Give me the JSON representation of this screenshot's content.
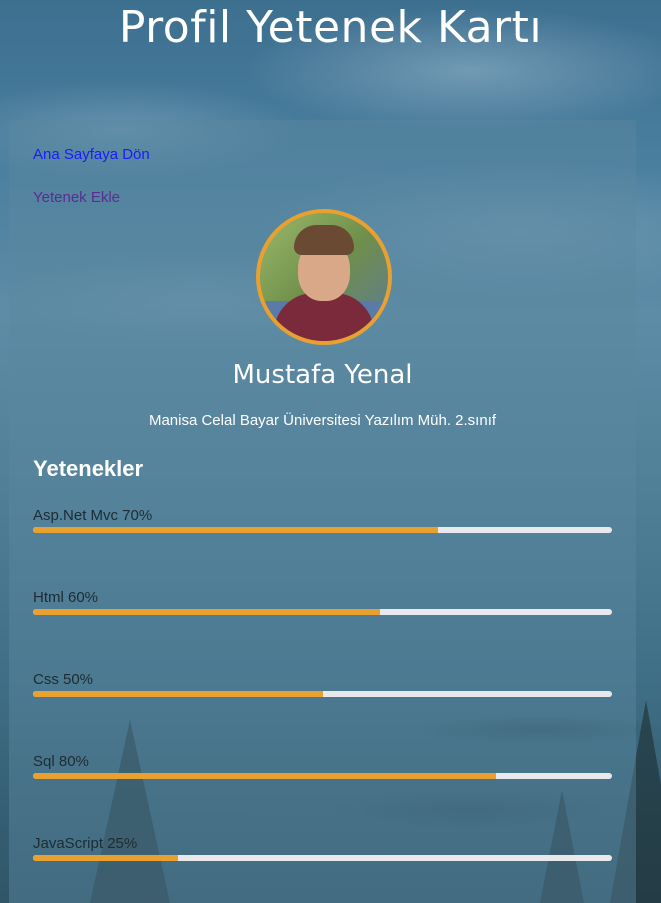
{
  "page": {
    "title": "Profil Yetenek Kartı"
  },
  "nav": {
    "home_label": "Ana Sayfaya Dön",
    "add_skill_label": "Yetenek Ekle"
  },
  "profile": {
    "name": "Mustafa Yenal",
    "description": "Manisa Celal Bayar Üniversitesi Yazılım Müh. 2.sınıf"
  },
  "skills_heading": "Yetenekler",
  "skills": [
    {
      "label": "Asp.Net Mvc 70%",
      "percent": 70
    },
    {
      "label": "Html 60%",
      "percent": 60
    },
    {
      "label": "Css 50%",
      "percent": 50
    },
    {
      "label": "Sql 80%",
      "percent": 80
    },
    {
      "label": "JavaScript 25%",
      "percent": 25
    }
  ],
  "colors": {
    "accent": "#e8a030",
    "track": "#e9e9ec",
    "link": "#1a1aff",
    "link_visited": "#5a2d91"
  }
}
